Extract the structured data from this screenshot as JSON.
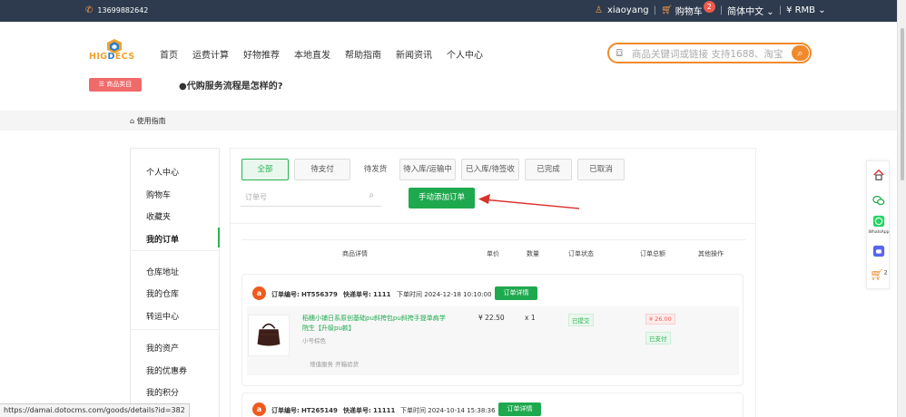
{
  "topbar": {
    "phone": "13699882642",
    "username": "xiaoyang",
    "cart_label": "购物车",
    "cart_count": "2",
    "language": "简体中文",
    "currency": "¥ RMB"
  },
  "logo": {
    "text_left": "HIG",
    "text_mid": "D",
    "text_right": "ECS"
  },
  "nav": [
    "首页",
    "运费计算",
    "好物推荐",
    "本地直发",
    "帮助指南",
    "新闻资讯",
    "个人中心"
  ],
  "search": {
    "placeholder": "商品关键词或链接 支持1688、淘宝"
  },
  "category_button": "☰ 商品类目",
  "faq_link": "●代购服务流程是怎样的?",
  "breadcrumb": "使用指南",
  "sidebar": {
    "items": [
      "个人中心",
      "购物车",
      "收藏夹",
      "我的订单",
      "仓库地址",
      "我的仓库",
      "转运中心",
      "我的资产",
      "我的优惠券",
      "我的积分"
    ]
  },
  "tabs": [
    "全部",
    "待支付",
    "待发货",
    "待入库/运输中",
    "已入库/待签收",
    "已完成",
    "已取消"
  ],
  "order_search": {
    "placeholder": "订单号"
  },
  "add_order_button": "手动添加订单",
  "table_headers": [
    "商品详情",
    "单价",
    "数量",
    "订单状态",
    "订单总额",
    "其他操作"
  ],
  "orders": [
    {
      "order_no_label": "订单编号:",
      "order_no": "HT556379",
      "express_label": "快递单号:",
      "express_no": "1111",
      "time_label": "下单时间",
      "time": "2024-12-18 10:10:00",
      "detail_button": "订单详情",
      "goods": {
        "name": "稻穗小铺日系原创基础pu斜挎包pu斜挎手提单肩学院生【升级pu款】",
        "spec": "小号棕色",
        "price": "¥ 22.50",
        "qty": "x 1",
        "status": "已提交",
        "total": "¥ 26.00",
        "paid": "已支付",
        "services": "增值服务  开箱验货"
      }
    },
    {
      "order_no_label": "订单编号:",
      "order_no": "HT265149",
      "express_label": "快递单号:",
      "express_no": "11111",
      "time_label": "下单时间",
      "time": "2024-10-14 15:38:36",
      "detail_button": "订单详情"
    }
  ],
  "right_rail": {
    "whatsapp_label": "WhatsApp",
    "cart_count": "2"
  },
  "status_url": "https://damai.dotocms.com/goods/details?id=382",
  "colors": {
    "accent_green": "#1fa94e",
    "accent_orange": "#f08a2c",
    "topbar": "#2e3b4e",
    "danger": "#ee5a4d"
  }
}
